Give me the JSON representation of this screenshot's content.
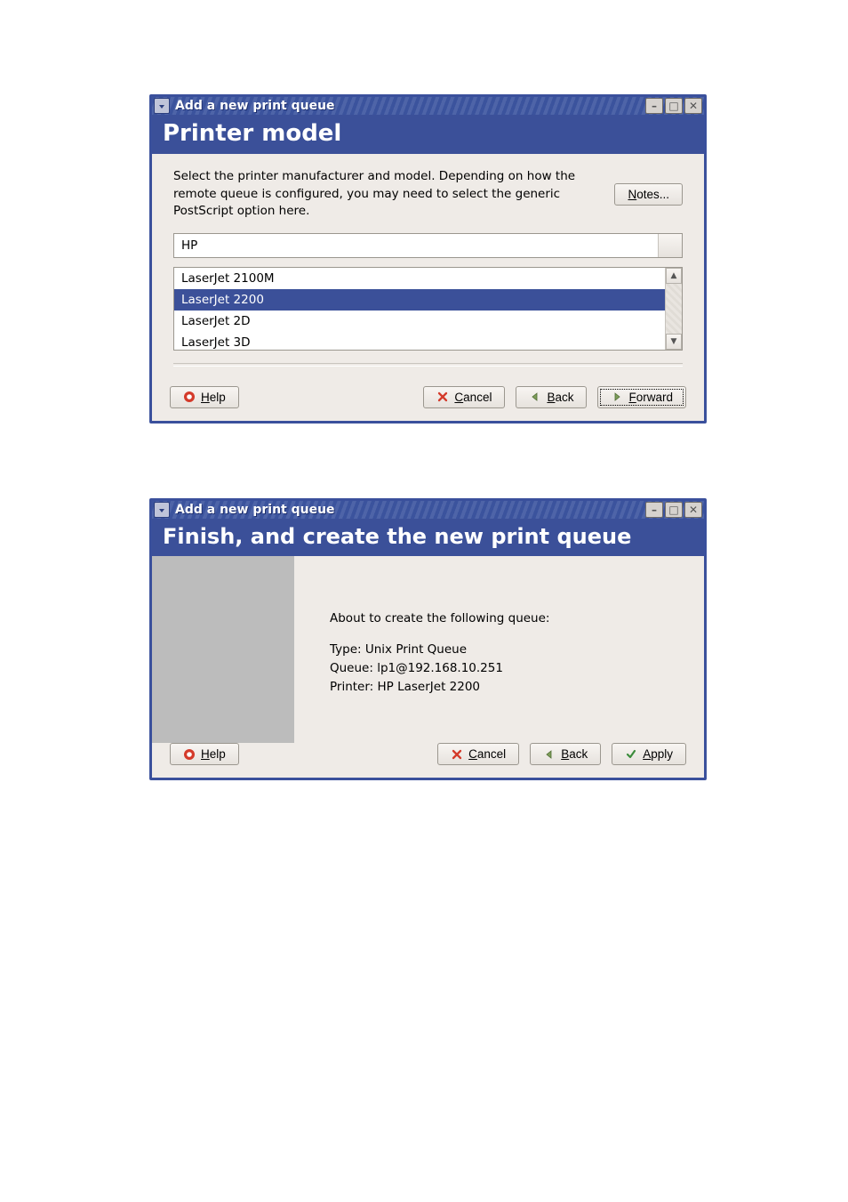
{
  "window_title": "Add a new print queue",
  "win1": {
    "banner": "Printer model",
    "instructions": "Select the printer manufacturer and model. Depending on how the remote queue is configured, you may need to select the generic PostScript option here.",
    "notes_label": "Notes...",
    "manufacturer": "HP",
    "models": [
      {
        "label": "LaserJet 2100M",
        "selected": false
      },
      {
        "label": "LaserJet 2200",
        "selected": true
      },
      {
        "label": "LaserJet 2D",
        "selected": false
      },
      {
        "label": "LaserJet 3D",
        "selected": false
      }
    ],
    "buttons": {
      "help": "Help",
      "cancel": "Cancel",
      "back": "Back",
      "forward": "Forward"
    }
  },
  "win2": {
    "banner": "Finish, and create the new print queue",
    "about": "About to create the following queue:",
    "type_line": "Type: Unix Print Queue",
    "queue_line": "Queue: lp1@192.168.10.251",
    "printer_line": "Printer: HP LaserJet 2200",
    "buttons": {
      "help": "Help",
      "cancel": "Cancel",
      "back": "Back",
      "apply": "Apply"
    }
  }
}
